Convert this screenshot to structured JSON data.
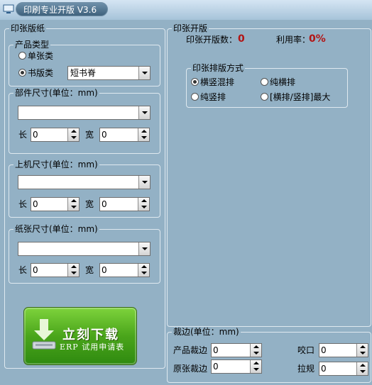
{
  "window": {
    "title": "印刷专业开版 V3.6"
  },
  "paper_panel": {
    "legend": "印张版纸",
    "product_type": {
      "legend": "产品类型",
      "option_single": "单张类",
      "option_book": "书版类",
      "selected": "书版类",
      "book_binding_value": "短书脊"
    },
    "part_size": {
      "legend": "部件尺寸(单位：mm)",
      "select_value": "",
      "length_label": "长",
      "length_value": "0",
      "width_label": "宽",
      "width_value": "0"
    },
    "press_size": {
      "legend": "上机尺寸(单位：mm)",
      "select_value": "",
      "length_label": "长",
      "length_value": "0",
      "width_label": "宽",
      "width_value": "0"
    },
    "paper_size": {
      "legend": "纸张尺寸(单位：mm)",
      "select_value": "",
      "length_label": "长",
      "length_value": "0",
      "width_label": "宽",
      "width_value": "0"
    },
    "download_button": {
      "main_text": "立刻下载",
      "sub_text": "ERP 试用申请表"
    }
  },
  "imposition_panel": {
    "legend": "印张开版",
    "count_label": "印张开版数：",
    "count_value": "0",
    "util_label": "利用率：",
    "util_value": "0%",
    "layout": {
      "legend": "印张排版方式",
      "opt_mixed": "横竖混排",
      "opt_horizontal": "纯横排",
      "opt_vertical": "纯竖排",
      "opt_max": "[横排/竖排]最大",
      "selected": "横竖混排"
    }
  },
  "trim_panel": {
    "legend": "裁边(单位：mm)",
    "product_trim_label": "产品裁边",
    "product_trim_value": "0",
    "original_trim_label": "原张裁边",
    "original_trim_value": "0",
    "gripper_label": "咬口",
    "gripper_value": "0",
    "side_guide_label": "拉规",
    "side_guide_value": "0"
  }
}
